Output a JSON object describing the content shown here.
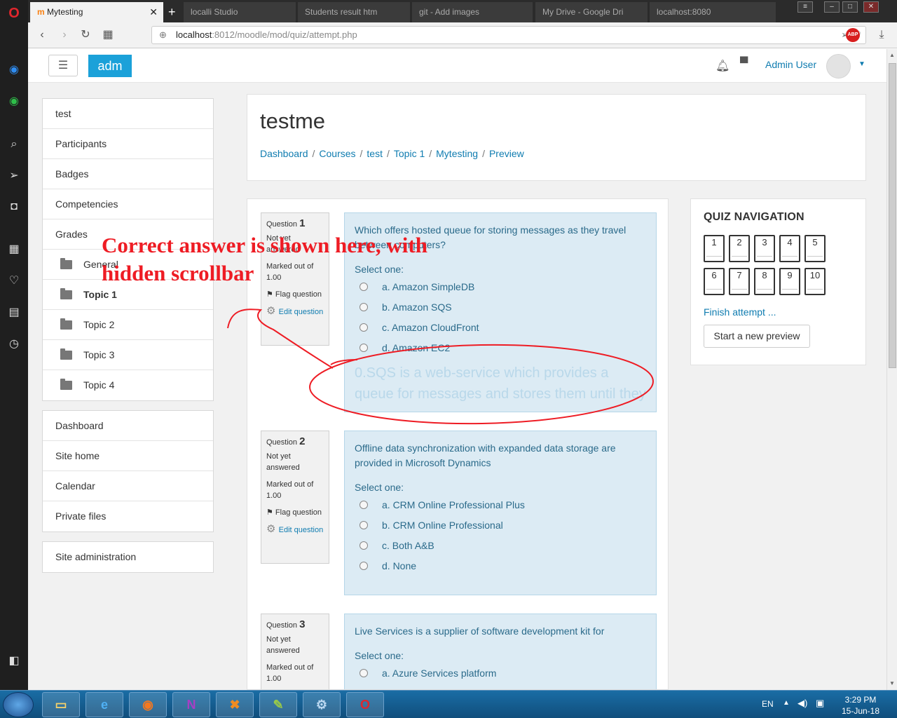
{
  "browser": {
    "tabs": [
      {
        "label": "Mytesting",
        "active": true
      },
      {
        "label": "localli Studio",
        "active": false
      },
      {
        "label": "Students result htm",
        "active": false
      },
      {
        "label": "git - Add images",
        "active": false
      },
      {
        "label": "My Drive - Google Dri",
        "active": false
      },
      {
        "label": "localhost:8080",
        "active": false
      }
    ],
    "url_host": "localhost",
    "url_rest": ":8012/moodle/mod/quiz/attempt.php",
    "abp_label": "ABP"
  },
  "header": {
    "brand": "adm",
    "menu_icon": "☰",
    "user_name": "Admin User"
  },
  "sidebar": {
    "course_nav": [
      {
        "label": "test",
        "type": "link"
      },
      {
        "label": "Participants",
        "type": "link"
      },
      {
        "label": "Badges",
        "type": "link"
      },
      {
        "label": "Competencies",
        "type": "link"
      },
      {
        "label": "Grades",
        "type": "link"
      },
      {
        "label": "General",
        "type": "folder"
      },
      {
        "label": "Topic 1",
        "type": "folder"
      },
      {
        "label": "Topic 2",
        "type": "folder"
      },
      {
        "label": "Topic 3",
        "type": "folder"
      },
      {
        "label": "Topic 4",
        "type": "folder"
      }
    ],
    "site_nav": [
      "Dashboard",
      "Site home",
      "Calendar",
      "Private files"
    ],
    "admin": "Site administration"
  },
  "page": {
    "title": "testme",
    "breadcrumb": [
      "Dashboard",
      "Courses",
      "test",
      "Topic 1",
      "Mytesting",
      "Preview"
    ]
  },
  "questions": [
    {
      "label": "Question",
      "number": "1",
      "state": "Not yet answered",
      "marks": "Marked out of 1.00",
      "flag": "Flag question",
      "edit": "Edit question",
      "text": "Which offers hosted queue for storing messages as they travel between computers?",
      "prompt": "Select one:",
      "options": [
        "a. Amazon SimpleDB",
        "b. Amazon SQS",
        "c. Amazon CloudFront",
        "d. Amazon EC2"
      ],
      "feedback": "0.SQS is a web-service which provides a queue for messages and stores them until they"
    },
    {
      "label": "Question",
      "number": "2",
      "state": "Not yet answered",
      "marks": "Marked out of 1.00",
      "flag": "Flag question",
      "edit": "Edit question",
      "text": "Offline data synchronization with expanded data storage are provided in Microsoft Dynamics",
      "prompt": "Select one:",
      "options": [
        "a. CRM Online Professional Plus",
        "b. CRM Online Professional",
        "c. Both A&B",
        "d. None"
      ]
    },
    {
      "label": "Question",
      "number": "3",
      "state": "Not yet answered",
      "marks": "Marked out of 1.00",
      "text": "Live Services is a supplier of software development kit for",
      "prompt": "Select one:",
      "options": [
        "a. Azure Services platform"
      ]
    }
  ],
  "quiz_nav": {
    "title": "QUIZ NAVIGATION",
    "buttons": [
      "1",
      "2",
      "3",
      "4",
      "5",
      "6",
      "7",
      "8",
      "9",
      "10"
    ],
    "finish": "Finish attempt ...",
    "new_preview": "Start a new preview"
  },
  "annotation": {
    "line1": "Correct answer is shown here, with",
    "line2": "hidden scrollbar",
    "color": "#ee1c24"
  },
  "taskbar": {
    "lang": "EN",
    "time": "3:29 PM",
    "date": "15-Jun-18"
  }
}
